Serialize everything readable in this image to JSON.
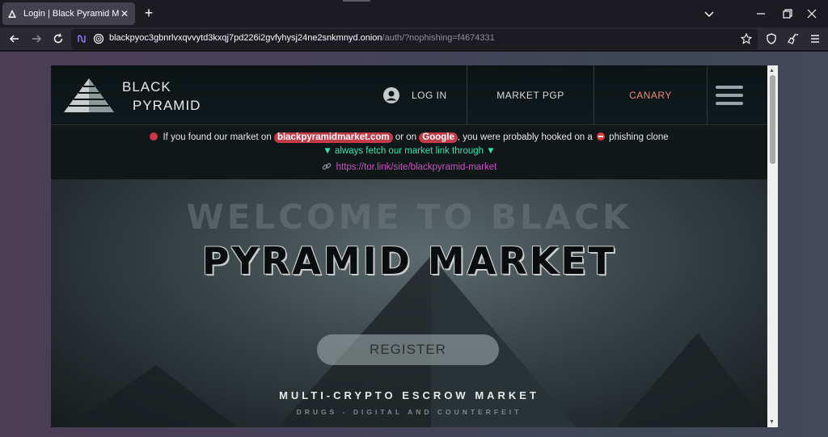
{
  "browser": {
    "tab_title": "Login | Black Pyramid Market",
    "url_host": "blackpyoc3gbnrlvxqvvytd3kxqj7pd226i2gvfyhysj24ne2snkmnyd.onion",
    "url_path": "/auth/?nophishing=f4674331"
  },
  "site": {
    "logo_line1": "BLACK",
    "logo_line2": "PYRAMID",
    "nav": {
      "login": "LOG IN",
      "pgp": "MARKET PGP",
      "canary": "CANARY"
    },
    "notice": {
      "part1": "If you found our market on",
      "pill1": "blackpyramidmarket.com",
      "part2": "or on",
      "pill2": "Google",
      "part3": ", you were probably hooked on a",
      "part4": "phishing clone",
      "line2": "▼ always fetch our market link through ▼",
      "link": "https://tor.link/site/blackpyramid-market"
    },
    "hero": {
      "welcome": "WELCOME TO BLACK",
      "title": "PYRAMID MARKET",
      "register": "REGISTER",
      "tagline": "MULTI-CRYPTO ESCROW MARKET",
      "subtagline": "DRUGS - DIGITAL AND COUNTERFEIT"
    }
  },
  "colors": {
    "canary": "#f08a7a",
    "warning_pill": "#c43a49",
    "fetch_text": "#2ee6b0",
    "link_text": "#d04fc4"
  }
}
